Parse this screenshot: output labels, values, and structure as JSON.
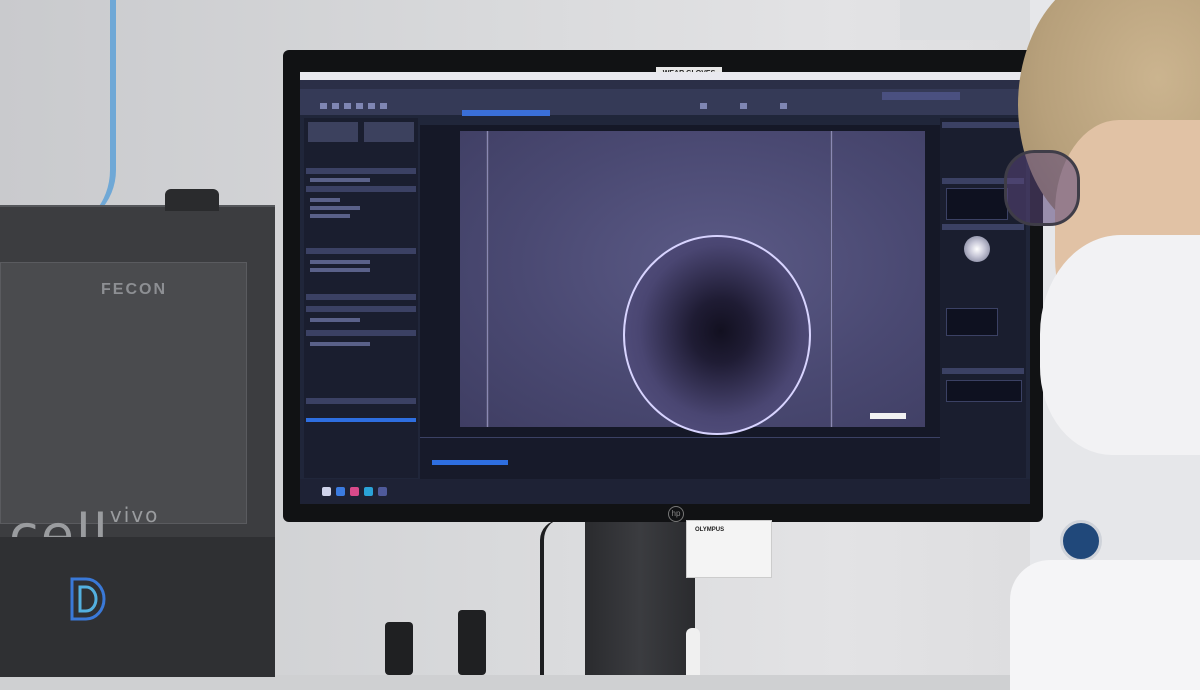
{
  "scene": {
    "description_tag": "lab-monitor-microscopy"
  },
  "instrument": {
    "logo": "FECON",
    "brand": "cell",
    "brand_sup": "vivo"
  },
  "monitor": {
    "sticker": "WEAR GLOVES",
    "maker_logo": "hp",
    "stand_card_title": "OLYMPUS"
  },
  "colors": {
    "ui_dark": "#1a1e2f",
    "ui_header": "#3b4164",
    "highlight": "#2e6ee0",
    "micrograph_tint": "#4a4972"
  }
}
